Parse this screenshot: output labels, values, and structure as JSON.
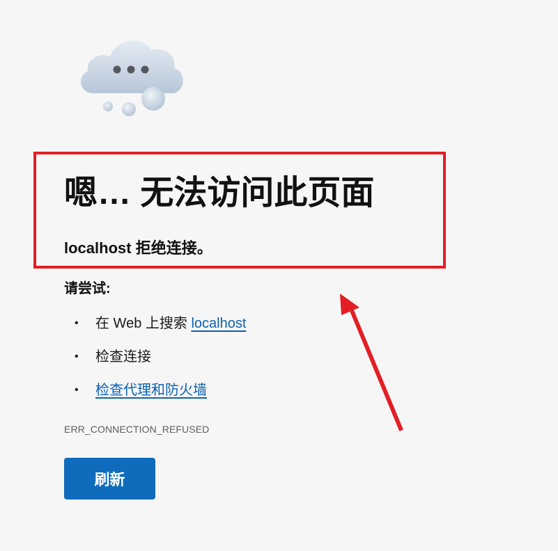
{
  "page": {
    "title": "嗯… 无法访问此页面",
    "subtitle_host": "localhost",
    "subtitle_rest": " 拒绝连接。",
    "try_label": "请尝试:",
    "suggestions": [
      {
        "prefix": "在 Web 上搜索 ",
        "link": "localhost"
      },
      {
        "text": "检查连接"
      },
      {
        "link": "检查代理和防火墙"
      }
    ],
    "bullet": "•",
    "error_code": "ERR_CONNECTION_REFUSED",
    "refresh_label": "刷新"
  },
  "icons": {
    "hero": "cloud-with-ellipsis-icon"
  },
  "annotations": {
    "highlight_box_color": "#e31e24",
    "arrow_color": "#e31e24"
  },
  "colors": {
    "background": "#f6f6f6",
    "accent": "#0f6cbd",
    "link": "#0b62b2"
  }
}
